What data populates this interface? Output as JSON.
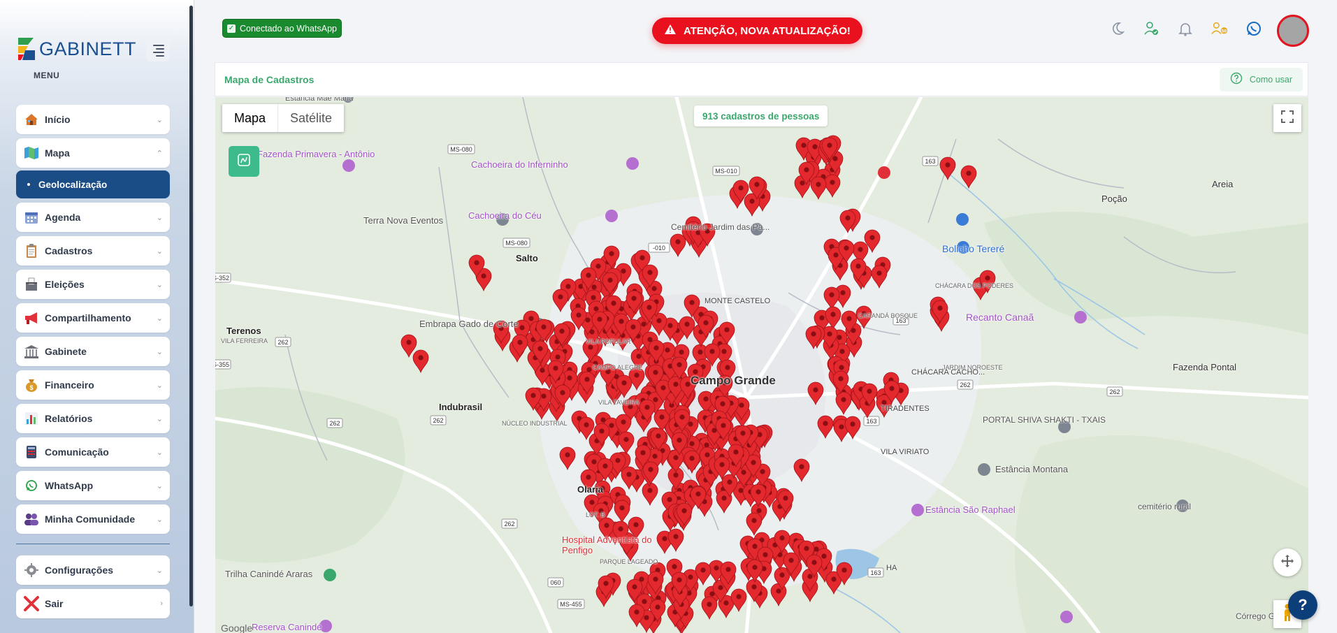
{
  "sidebar": {
    "brand": "GABINETT",
    "menu_label": "MENU",
    "items": [
      {
        "label": "Início",
        "icon": "house-icon",
        "expanded": false
      },
      {
        "label": "Mapa",
        "icon": "map-icon",
        "expanded": true
      },
      {
        "label": "Agenda",
        "icon": "calendar-icon",
        "expanded": false
      },
      {
        "label": "Cadastros",
        "icon": "clipboard-icon",
        "expanded": false
      },
      {
        "label": "Eleições",
        "icon": "ballot-box-icon",
        "expanded": false
      },
      {
        "label": "Compartilhamento",
        "icon": "megaphone-icon",
        "expanded": false
      },
      {
        "label": "Gabinete",
        "icon": "building-icon",
        "expanded": false
      },
      {
        "label": "Financeiro",
        "icon": "money-bag-icon",
        "expanded": false
      },
      {
        "label": "Relatórios",
        "icon": "bar-chart-icon",
        "expanded": false
      },
      {
        "label": "Comunicação",
        "icon": "phone-icon",
        "expanded": false
      },
      {
        "label": "WhatsApp",
        "icon": "whatsapp-icon",
        "expanded": false
      },
      {
        "label": "Minha Comunidade",
        "icon": "people-icon",
        "expanded": false
      }
    ],
    "sub_item": "Geolocalização",
    "bottom_items": [
      {
        "label": "Configurações",
        "icon": "gear-icon"
      },
      {
        "label": "Sair",
        "icon": "close-icon"
      }
    ]
  },
  "topbar": {
    "whatsapp_status": "Conectado ao WhatsApp",
    "alert": "ATENÇÃO, NOVA ATUALIZAÇÃO!",
    "icons": [
      "moon-icon",
      "user-check-icon",
      "bell-icon",
      "users-birthday-icon",
      "whatsapp-icon"
    ]
  },
  "card": {
    "title": "Mapa de Cadastros",
    "how_to": "Como usar"
  },
  "map": {
    "type_options": [
      "Mapa",
      "Satélite"
    ],
    "selected_type": "Mapa",
    "record_count": "913 cadastros de pessoas",
    "attribution": "Google",
    "place_labels": [
      "Estância Mãe Maria",
      "Fazenda Primavera - Antônio",
      "Cachoeira do Inferninho",
      "Terra Nova Eventos",
      "Cachoeira do Céu",
      "Cemitério Jardim das Pa...",
      "Salto",
      "Terenos",
      "VILA FERREIRA",
      "Embrapa Gado de Corte",
      "Indubrasil",
      "NÚCLEO INDUSTRIAL",
      "Olaria",
      "Hospital Adventista do Penfigo",
      "Trilha Canindé Araras",
      "Reserva Canindé",
      "Bolicho Tereré",
      "Recanto Canaã",
      "CHÁCARA DOS PODERES",
      "Poção",
      "Areia",
      "Fazenda Pontal",
      "JARDIM NOROESTE",
      "PORTAL SHIVA SHAKTI - TXAIS",
      "Estância Montana",
      "Estância São Raphael",
      "cemitério rural",
      "Córrego G...",
      "Campo Grande",
      "MONTE CASTELO",
      "CARANDÁ BOSQUE",
      "CHÁCARA CACHO...",
      "TIRADENTES",
      "VILA VIRIATO",
      "VILA POPULAR",
      "CAMPO ALEGRE",
      "VILA TAVEIRA",
      "LOT. B",
      "PARQUE LAGEADO",
      "HA"
    ],
    "route_shields": [
      "MS-080",
      "MS-010",
      "163",
      "262",
      "MS-455",
      "060",
      "S-352",
      "S-355"
    ]
  }
}
